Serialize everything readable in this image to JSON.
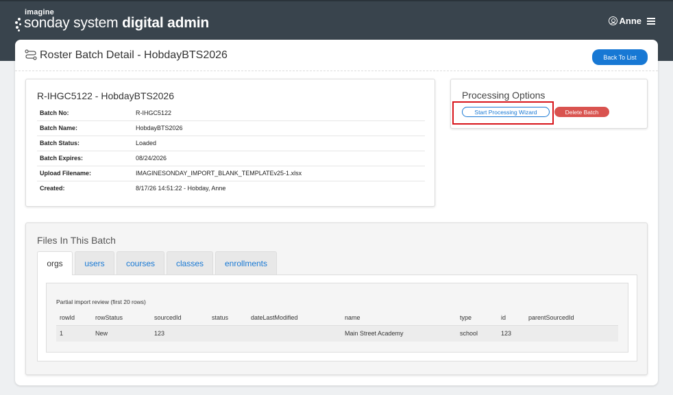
{
  "brand": {
    "small": "imagine",
    "main_light": "sonday system",
    "main_bold": "digital admin"
  },
  "user": {
    "name": "Anne",
    "user_icon": "person-circle-icon",
    "menu_icon": "hamburger-icon"
  },
  "page": {
    "title": "Roster Batch Detail - HobdayBTS2026",
    "title_icon": "route-icon",
    "back_label": "Back To List"
  },
  "batch": {
    "heading": "R-IHGC5122 - HobdayBTS2026",
    "fields": [
      {
        "label": "Batch No:",
        "value": "R-IHGC5122"
      },
      {
        "label": "Batch Name:",
        "value": "HobdayBTS2026"
      },
      {
        "label": "Batch Status:",
        "value": "Loaded"
      },
      {
        "label": "Batch Expires:",
        "value": "08/24/2026"
      },
      {
        "label": "Upload Filename:",
        "value": "IMAGINESONDAY_IMPORT_BLANK_TEMPLATEv25-1.xlsx"
      },
      {
        "label": "Created:",
        "value": "8/17/26 14:51:22 - Hobday, Anne"
      }
    ]
  },
  "processing": {
    "title": "Processing Options",
    "wizard_label": "Start Processing Wizard",
    "delete_label": "Delete Batch"
  },
  "files": {
    "title": "Files In This Batch",
    "tabs": [
      "orgs",
      "users",
      "courses",
      "classes",
      "enrollments"
    ],
    "active_tab": "orgs",
    "caption": "Partial import review (first 20 rows)",
    "columns": [
      "rowId",
      "rowStatus",
      "sourcedId",
      "status",
      "dateLastModified",
      "name",
      "type",
      "id",
      "parentSourcedId"
    ],
    "rows": [
      [
        "1",
        "New",
        "123",
        "",
        "",
        "Main Street Academy",
        "school",
        "123",
        ""
      ]
    ]
  },
  "colors": {
    "topbar": "#39444d",
    "primary": "#1778d4",
    "danger": "#d9534f",
    "highlight": "#d8141a"
  }
}
